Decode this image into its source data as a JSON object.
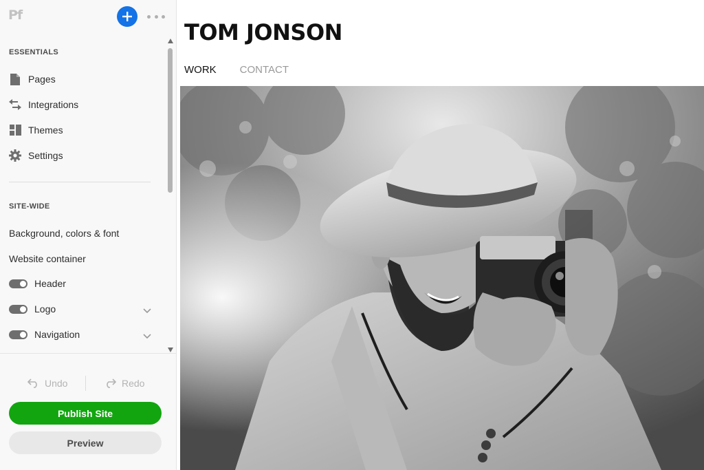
{
  "app": {
    "logo_text": "Pf",
    "add_icon": "plus-icon",
    "more_icon": "more-dots-icon"
  },
  "sidebar": {
    "essentials_title": "ESSENTIALS",
    "essentials": [
      {
        "label": "Pages",
        "icon": "page-icon"
      },
      {
        "label": "Integrations",
        "icon": "swap-arrows-icon"
      },
      {
        "label": "Themes",
        "icon": "themes-grid-icon"
      },
      {
        "label": "Settings",
        "icon": "gear-icon"
      }
    ],
    "sitewide_title": "SITE-WIDE",
    "sitewide_links": [
      "Background, colors & font",
      "Website container"
    ],
    "toggles": [
      {
        "label": "Header",
        "on": true,
        "expandable": false
      },
      {
        "label": "Logo",
        "on": true,
        "expandable": true
      },
      {
        "label": "Navigation",
        "on": true,
        "expandable": true
      }
    ]
  },
  "footer": {
    "undo_label": "Undo",
    "redo_label": "Redo",
    "publish_label": "Publish Site",
    "preview_label": "Preview"
  },
  "site": {
    "title": "TOM JONSON",
    "nav": [
      {
        "label": "WORK",
        "active": true
      },
      {
        "label": "CONTACT",
        "active": false
      }
    ],
    "hero_image": "photographer-with-camera-image"
  },
  "colors": {
    "accent_blue": "#1473e6",
    "publish_green": "#12a50f",
    "sidebar_bg": "#f8f8f8"
  }
}
